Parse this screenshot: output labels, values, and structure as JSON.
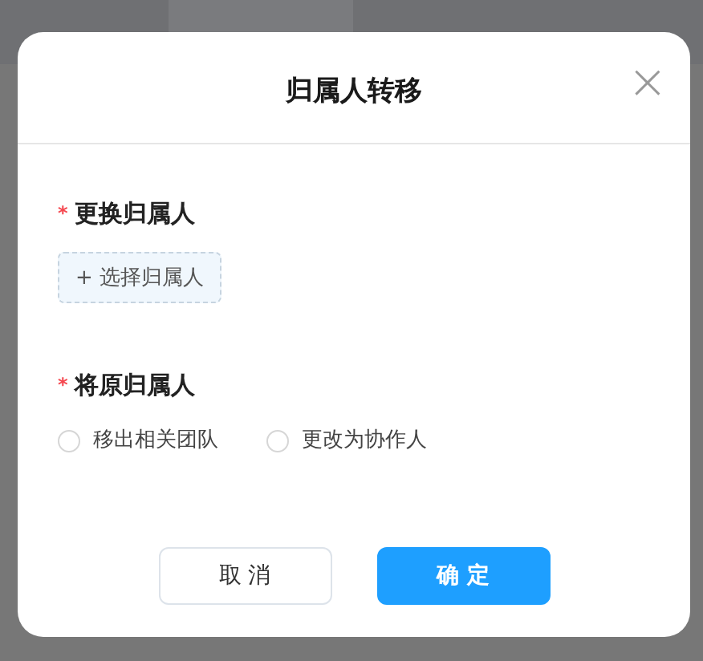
{
  "dialog": {
    "title": "归属人转移",
    "close": "×",
    "fields": [
      {
        "kind": "picker",
        "marker": "*",
        "label": "更换归属人",
        "button": "+ 选择归属人"
      },
      {
        "kind": "radio",
        "marker": "*",
        "label": "将原归属人",
        "options": [
          {
            "label": "移出相关团队",
            "selected": false
          },
          {
            "label": "更改为协作人",
            "selected": false
          }
        ]
      }
    ],
    "buttons": [
      {
        "label": "取 消",
        "kind": "secondary"
      },
      {
        "label": "确 定",
        "kind": "primary"
      }
    ]
  }
}
